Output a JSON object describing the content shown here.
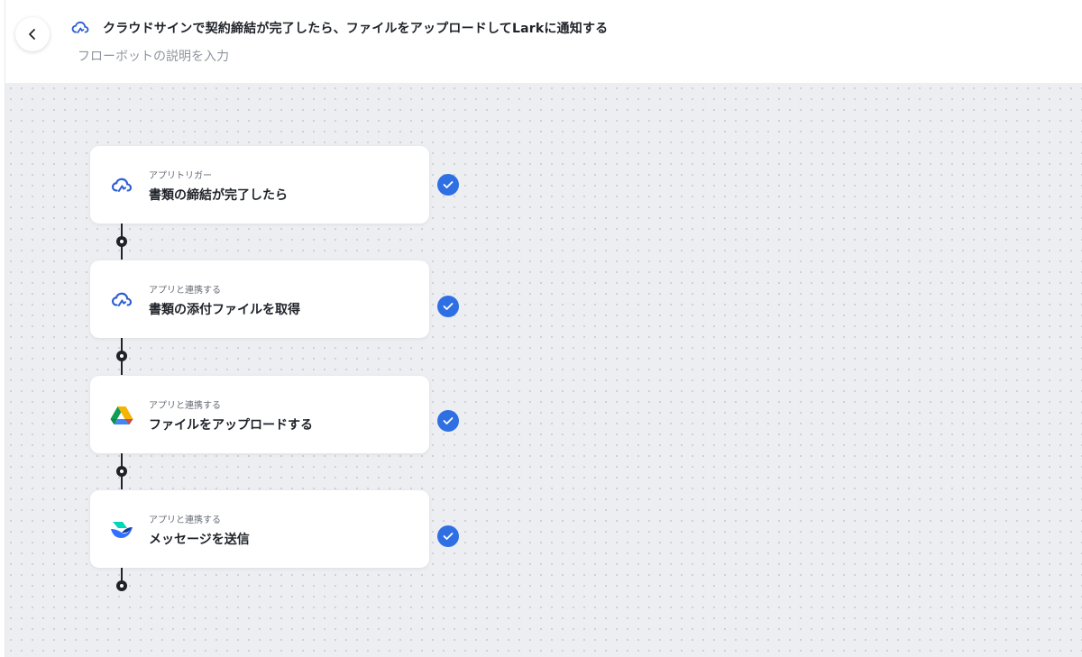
{
  "header": {
    "back_label": "",
    "title": "クラウドサインで契約締結が完了したら、ファイルをアップロードしてLarkに通知する",
    "description_placeholder": "フローボットの説明を入力",
    "icon": "cloudsign-cloud-icon"
  },
  "flow": {
    "nodes": [
      {
        "type_label": "アプリトリガー",
        "title": "書類の締結が完了したら",
        "app_icon": "cloudsign-cloud-icon",
        "status": "completed"
      },
      {
        "type_label": "アプリと連携する",
        "title": "書類の添付ファイルを取得",
        "app_icon": "cloudsign-cloud-icon",
        "status": "completed"
      },
      {
        "type_label": "アプリと連携する",
        "title": "ファイルをアップロードする",
        "app_icon": "google-drive-icon",
        "status": "completed"
      },
      {
        "type_label": "アプリと連携する",
        "title": "メッセージを送信",
        "app_icon": "lark-icon",
        "status": "completed"
      }
    ]
  },
  "colors": {
    "accent": "#2f6fe4",
    "cloudsign_blue": "#2d5fd3",
    "canvas_bg": "#eceef2",
    "connector": "#1f2329"
  }
}
